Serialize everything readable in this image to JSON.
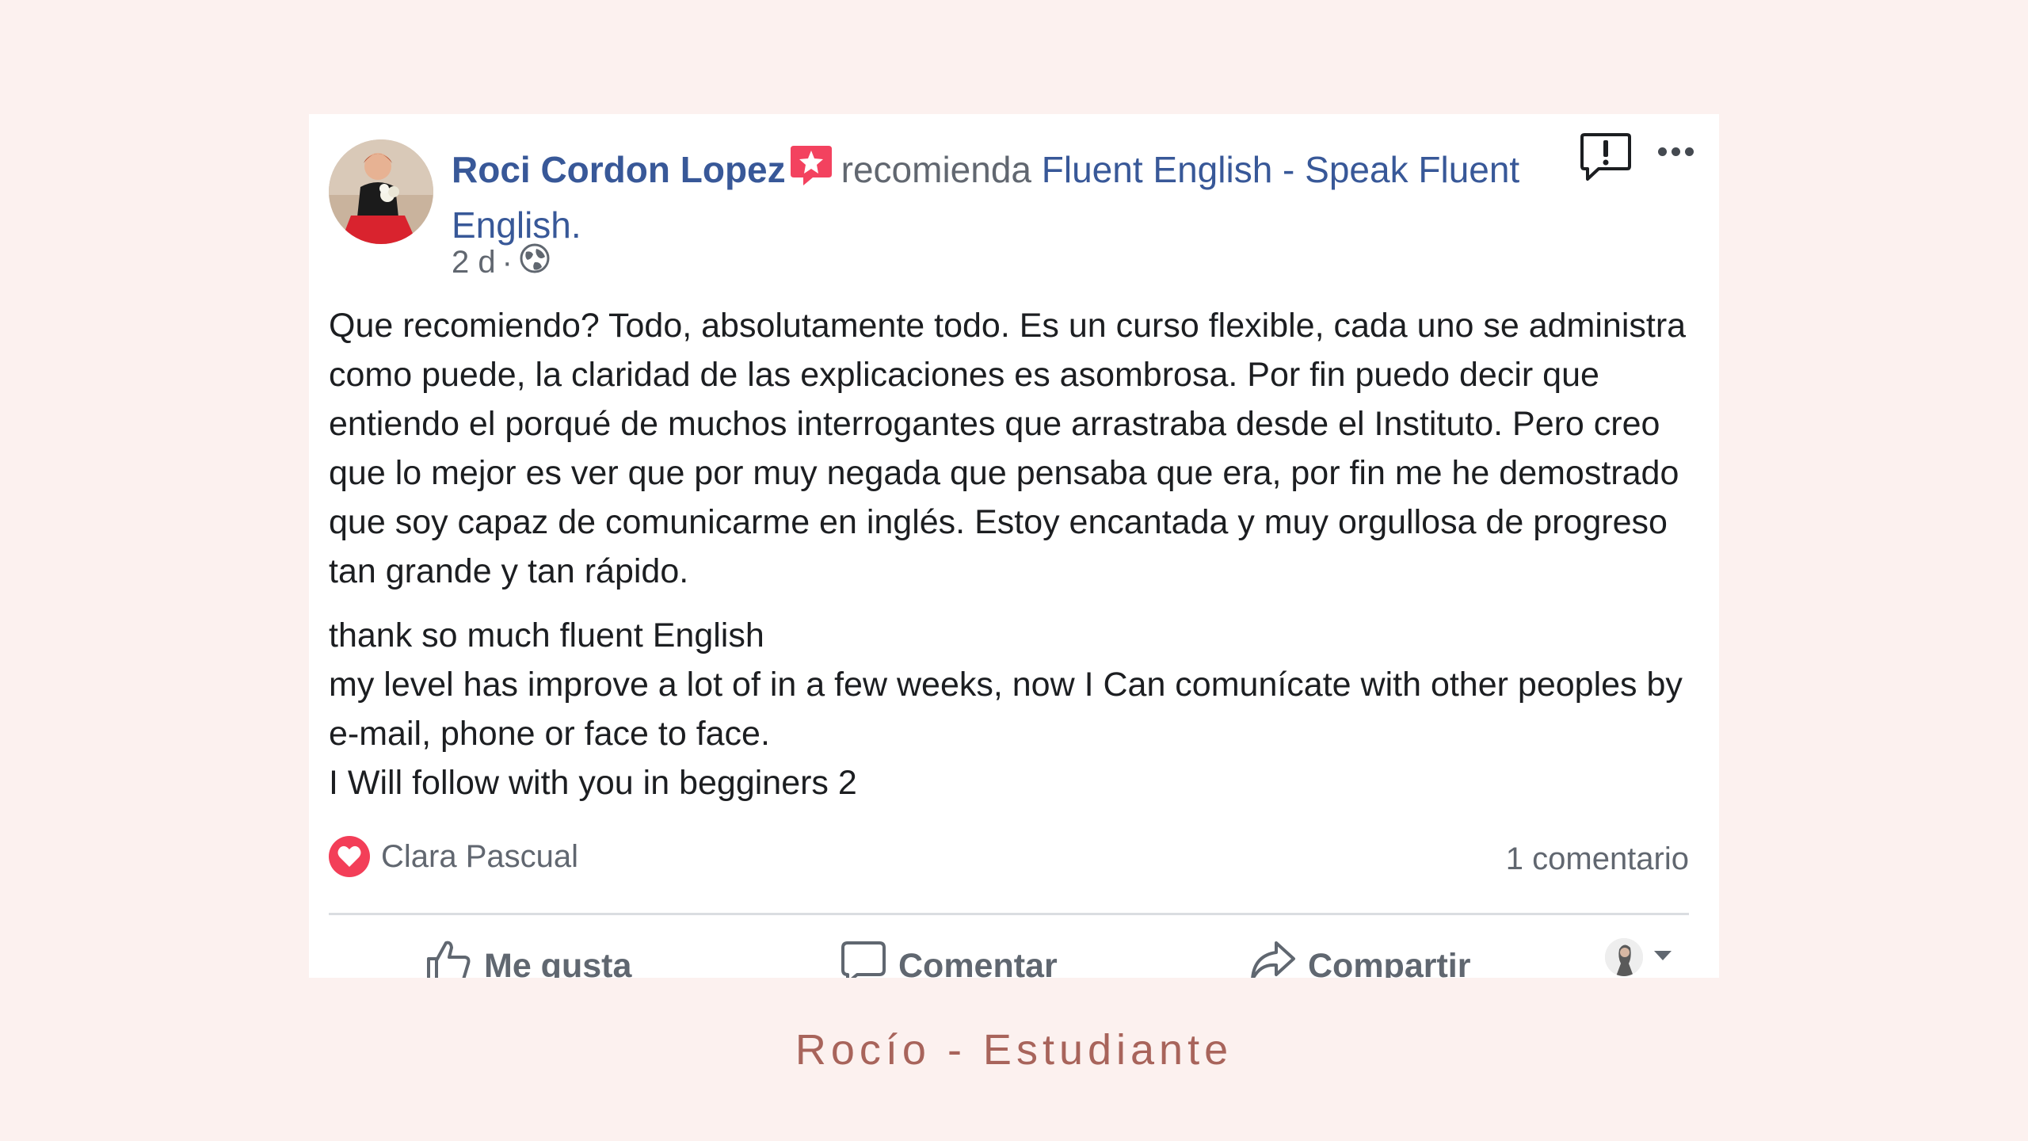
{
  "post": {
    "author_name": "Roci Cordon Lopez",
    "recommends_text": "recomienda",
    "page_name": "Fluent English - Speak Fluent English.",
    "time": "2 d",
    "separator": "·",
    "icons": {
      "recommendation_badge": "recommendation-star-icon",
      "privacy": "globe-icon",
      "report": "report-icon",
      "more": "more-options-icon"
    },
    "body_paragraph_1": "Que recomiendo? Todo, absolutamente todo. Es un curso flexible, cada uno se administra como puede, la claridad de las explicaciones es asombrosa. Por fin puedo decir que entiendo el porqué de muchos interrogantes que arrastraba desde el Instituto. Pero creo que lo mejor es ver que por muy negada que pensaba que era, por fin me he demostrado que soy capaz de comunicarme en inglés. Estoy encantada y muy orgullosa de progreso tan grande y tan rápido.",
    "body_lines_2": [
      "thank so much fluent English",
      "my level has improve a lot of in a few weeks, now I Can comunícate with other peoples by e-mail, phone or face to face.",
      "I Will follow with you in begginers 2"
    ],
    "reaction_name": "Clara Pascual",
    "comment_count": "1 comentario",
    "actions": {
      "like": "Me gusta",
      "comment": "Comentar",
      "share": "Compartir"
    }
  },
  "caption": "Rocío - Estudiante",
  "colors": {
    "background": "#fcf1ef",
    "link_blue": "#385898",
    "caption": "#a8645b",
    "heart": "#f33e58",
    "badge": "#f3425f"
  }
}
